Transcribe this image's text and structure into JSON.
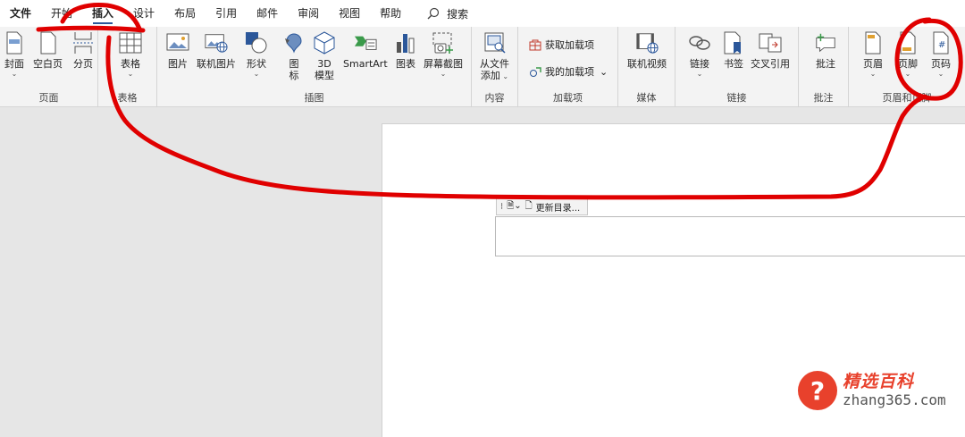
{
  "menu": {
    "tabs": [
      "文件",
      "开始",
      "插入",
      "设计",
      "布局",
      "引用",
      "邮件",
      "审阅",
      "视图",
      "帮助"
    ],
    "active_tab": "插入",
    "search_label": "搜索"
  },
  "ribbon": {
    "page_group": {
      "label": "页面",
      "buttons": [
        "封面",
        "空白页",
        "分页"
      ]
    },
    "table_group": {
      "label": "表格",
      "buttons": [
        "表格"
      ]
    },
    "illustrations_group": {
      "label": "插图",
      "buttons": [
        "图片",
        "联机图片",
        "形状",
        "图",
        "标",
        "3D",
        "模型",
        "SmartArt",
        "图表",
        "屏幕截图"
      ]
    },
    "content_group": {
      "label": "内容",
      "buttons": [
        "从文件",
        "添加"
      ]
    },
    "addins_group": {
      "label": "加载项",
      "buttons": [
        "获取加载项",
        "我的加载项"
      ]
    },
    "media_group": {
      "label": "媒体",
      "buttons": [
        "联机视频"
      ]
    },
    "links_group": {
      "label": "链接",
      "buttons": [
        "链接",
        "书签",
        "交叉引用"
      ]
    },
    "comments_group": {
      "label": "批注",
      "buttons": [
        "批注"
      ]
    },
    "header_footer_group": {
      "label": "页眉和页脚",
      "buttons": [
        "页眉",
        "页脚",
        "页码"
      ]
    }
  },
  "document": {
    "toc_update_label": "更新目录..."
  },
  "watermark": {
    "logo_char": "?",
    "site_name": "精选百科",
    "url": "zhang365.com"
  },
  "annotation_color": "#e00000",
  "accent_color": "#2b579a"
}
